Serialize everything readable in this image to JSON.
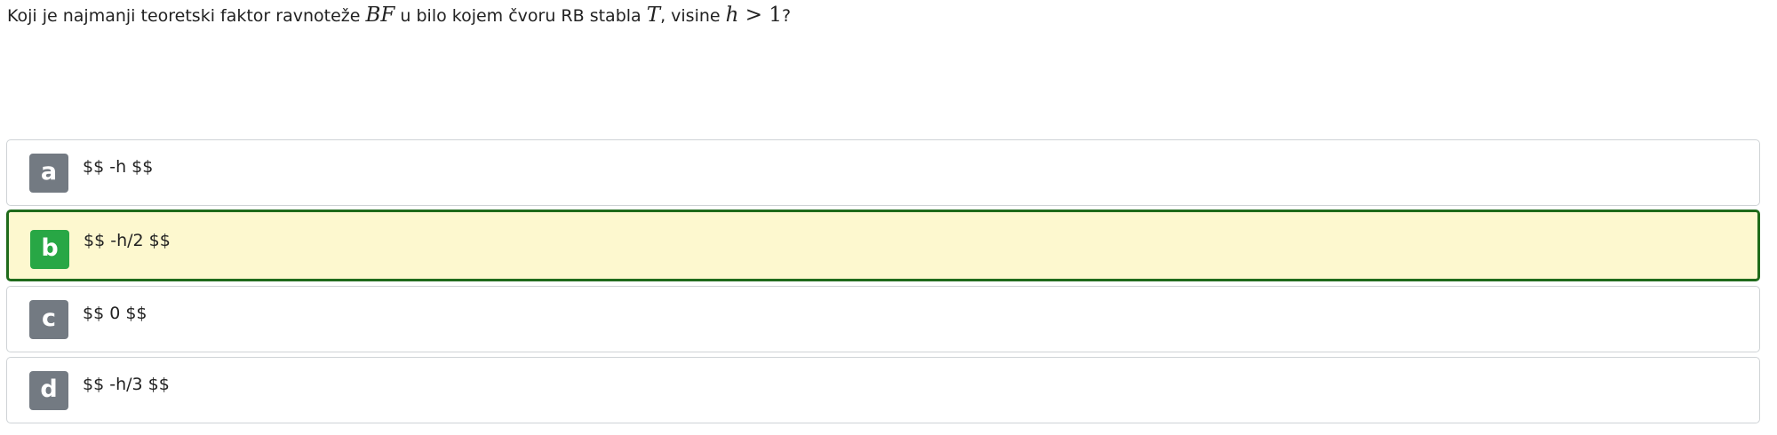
{
  "question": {
    "text_before": "Koji je najmanji teoretski faktor ravnoteže ",
    "math_bf": "BF",
    "text_middle": " u bilo kojem čvoru RB stabla ",
    "math_t": "T",
    "text_after_t": ", visine ",
    "math_h": "h",
    "math_gt_one": " > 1",
    "text_end": "?"
  },
  "answers": [
    {
      "letter": "a",
      "text": "$$ -h $$",
      "selected": false
    },
    {
      "letter": "b",
      "text": "$$ -h/2 $$",
      "selected": true
    },
    {
      "letter": "c",
      "text": "$$ 0 $$",
      "selected": false
    },
    {
      "letter": "d",
      "text": "$$ -h/3 $$",
      "selected": false
    }
  ],
  "colors": {
    "selected_border": "#1f6b1b",
    "selected_background": "#fdf8cf",
    "selected_badge": "#28a745",
    "default_badge": "#737a82",
    "default_border": "#cfd3d6"
  }
}
